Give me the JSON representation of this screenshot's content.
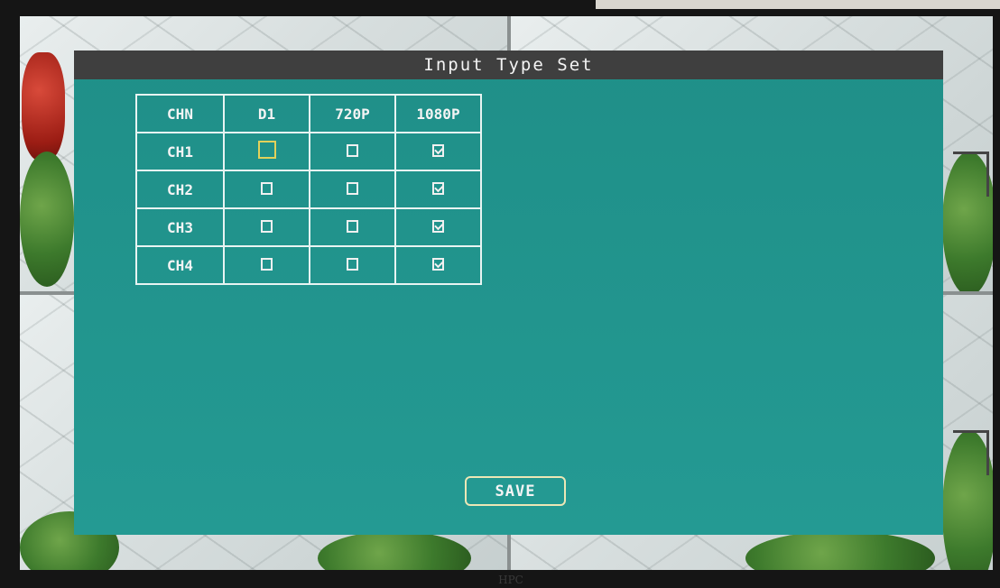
{
  "dialog": {
    "title": "Input Type Set",
    "table": {
      "headers": [
        "CHN",
        "D1",
        "720P",
        "1080P"
      ],
      "rows": [
        {
          "label": "CH1",
          "d1": false,
          "p720": false,
          "p1080": true
        },
        {
          "label": "CH2",
          "d1": false,
          "p720": false,
          "p1080": true
        },
        {
          "label": "CH3",
          "d1": false,
          "p720": false,
          "p1080": true
        },
        {
          "label": "CH4",
          "d1": false,
          "p720": false,
          "p1080": true
        }
      ]
    },
    "save_label": "SAVE"
  },
  "bezel": {
    "brand": "HPC"
  },
  "colors": {
    "dialog_bg": "#21938c",
    "titlebar_bg": "#3f3f3f",
    "focus": "#e2d15a",
    "button_border": "#ece7b6"
  }
}
